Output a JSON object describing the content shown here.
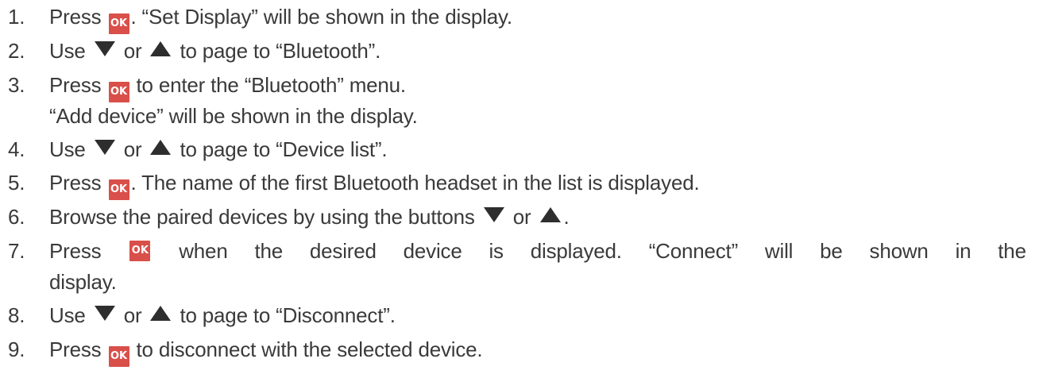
{
  "steps": [
    {
      "num": "1.",
      "a": "Press",
      "b": ". “Set Display” will be shown in the display."
    },
    {
      "num": "2.",
      "a": "Use",
      "b": "or",
      "c": "to page to “Bluetooth”."
    },
    {
      "num": "3.",
      "a": "Press",
      "b": "to enter the “Bluetooth” menu.",
      "cont": "“Add device” will be shown in the display."
    },
    {
      "num": "4.",
      "a": "Use",
      "b": "or",
      "c": "to page to “Device list”."
    },
    {
      "num": "5.",
      "a": "Press",
      "b": ". The name of the first Bluetooth headset in the list is displayed."
    },
    {
      "num": "6.",
      "a": "Browse the paired devices by using the buttons",
      "b": "or",
      "c": "."
    },
    {
      "num": "7.",
      "words": [
        "Press",
        "when",
        "the",
        "desired",
        "device",
        "is",
        "displayed.",
        "“Connect”",
        "will",
        "be",
        "shown",
        "in",
        "the"
      ],
      "cont": "display."
    },
    {
      "num": "8.",
      "a": "Use",
      "b": "or",
      "c": "to page to “Disconnect”."
    },
    {
      "num": "9.",
      "a": "Press",
      "b": "to disconnect with the selected device."
    }
  ],
  "icons": {
    "ok_label": "OK",
    "ok_color": "#d94f4a",
    "down": "down-triangle",
    "up": "up-triangle"
  }
}
